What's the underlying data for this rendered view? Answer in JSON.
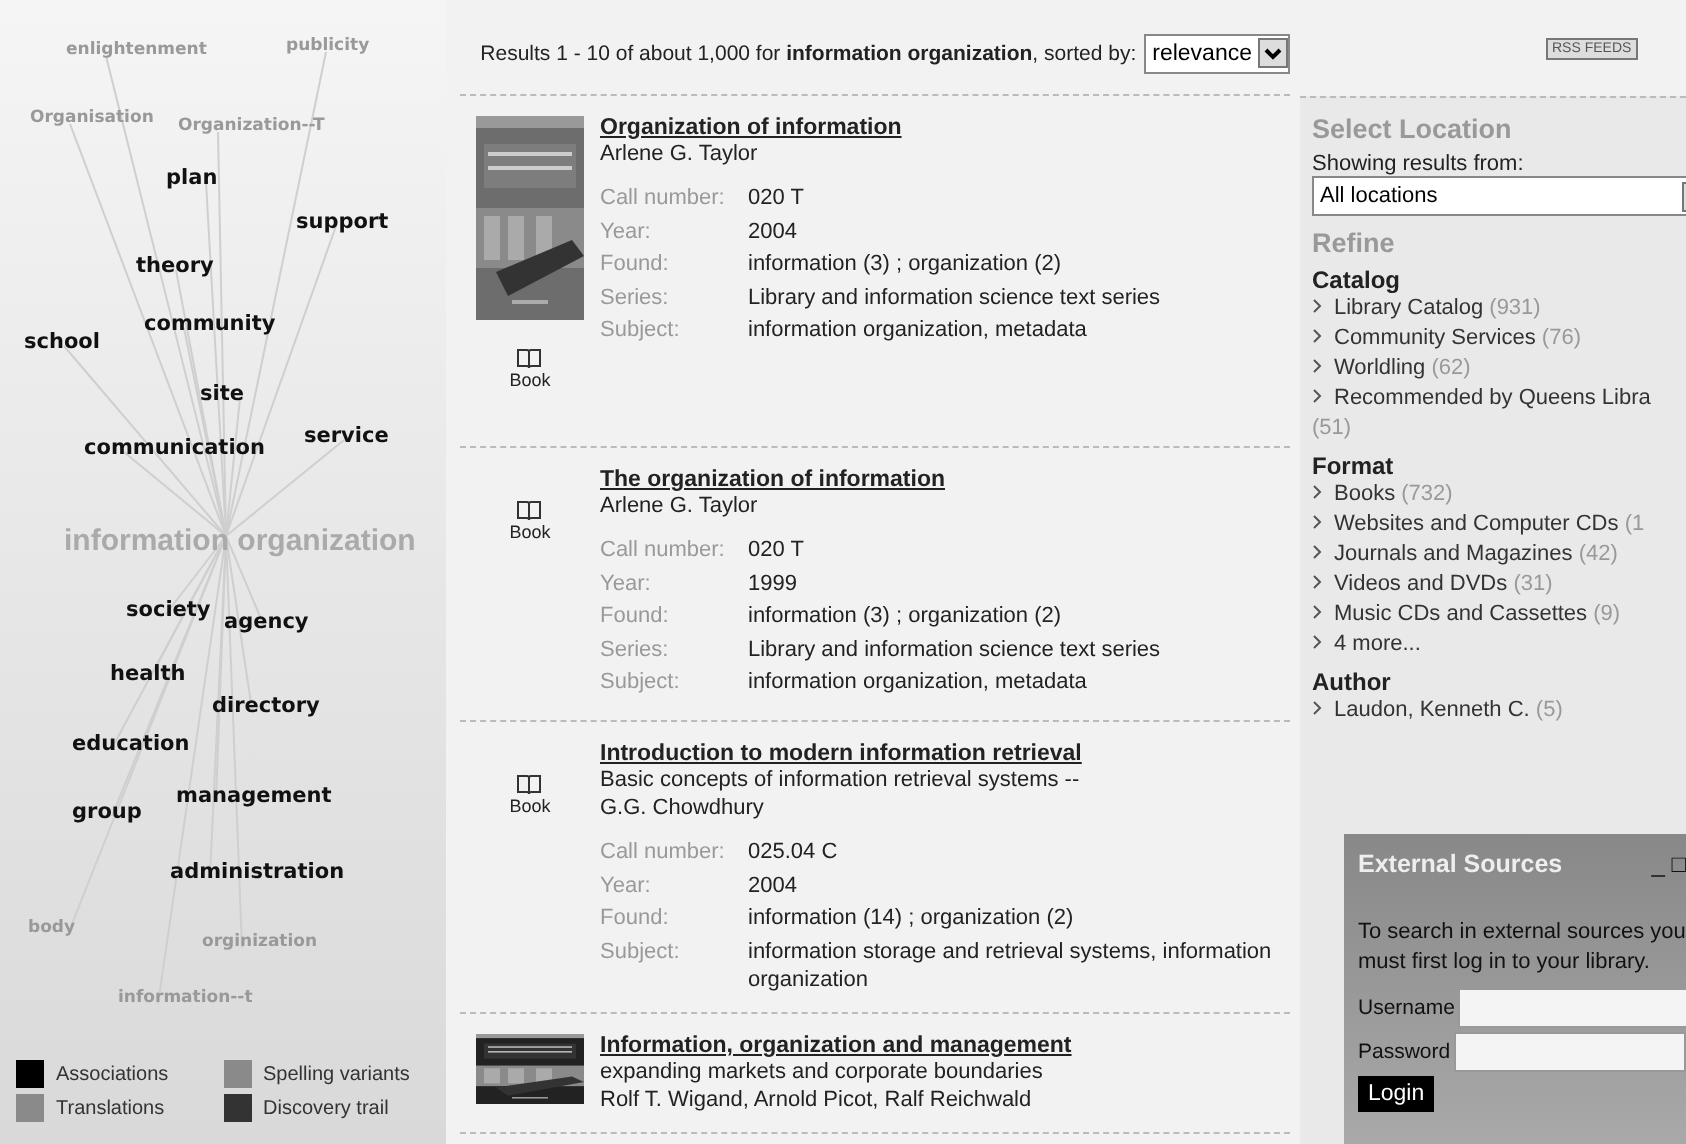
{
  "word_cloud": {
    "center": "information organization",
    "words": [
      {
        "text": "enlightenment",
        "kind": "variant"
      },
      {
        "text": "publicity",
        "kind": "variant"
      },
      {
        "text": "Organisation",
        "kind": "variant"
      },
      {
        "text": "Organization--T",
        "kind": "variant"
      },
      {
        "text": "plan",
        "kind": "association"
      },
      {
        "text": "support",
        "kind": "association"
      },
      {
        "text": "theory",
        "kind": "association"
      },
      {
        "text": "community",
        "kind": "association"
      },
      {
        "text": "school",
        "kind": "association"
      },
      {
        "text": "site",
        "kind": "association"
      },
      {
        "text": "communication",
        "kind": "association"
      },
      {
        "text": "service",
        "kind": "association"
      },
      {
        "text": "society",
        "kind": "association"
      },
      {
        "text": "agency",
        "kind": "association"
      },
      {
        "text": "health",
        "kind": "association"
      },
      {
        "text": "directory",
        "kind": "association"
      },
      {
        "text": "education",
        "kind": "association"
      },
      {
        "text": "group",
        "kind": "association"
      },
      {
        "text": "management",
        "kind": "association"
      },
      {
        "text": "administration",
        "kind": "association"
      },
      {
        "text": "body",
        "kind": "variant"
      },
      {
        "text": "orginization",
        "kind": "variant"
      },
      {
        "text": "information--t",
        "kind": "variant"
      }
    ],
    "legend": [
      {
        "label": "Associations",
        "color": "#000000"
      },
      {
        "label": "Spelling variants",
        "color": "#8a8a8a"
      },
      {
        "label": "Translations",
        "color": "#8a8a8a"
      },
      {
        "label": "Discovery trail",
        "color": "#333333"
      }
    ]
  },
  "results_header": {
    "summary": "Results 1 - 10 of about 1,000 for **information organization**, sorted by:",
    "sort": "relevance",
    "rss": "RSS FEEDS"
  },
  "results": [
    {
      "has_cover": true,
      "format": "Book",
      "title": "Organization of information",
      "lines": [
        "Arlene G. Taylor"
      ],
      "fields": [
        {
          "label": "Call number:",
          "value": "020 T"
        },
        {
          "label": "Year:",
          "value": "2004"
        },
        {
          "label": "Found:",
          "value": "information (3) ; organization (2)"
        },
        {
          "label": "Series:",
          "value": "Library and information science text series"
        },
        {
          "label": "Subject:",
          "value": "information organization, metadata"
        }
      ]
    },
    {
      "has_cover": false,
      "format": "Book",
      "title": "The organization of information",
      "lines": [
        "Arlene G. Taylor"
      ],
      "fields": [
        {
          "label": "Call number:",
          "value": "020 T"
        },
        {
          "label": "Year:",
          "value": "1999"
        },
        {
          "label": "Found:",
          "value": "information (3) ; organization (2)"
        },
        {
          "label": "Series:",
          "value": "Library and information science text series"
        },
        {
          "label": "Subject:",
          "value": "information organization, metadata"
        }
      ]
    },
    {
      "has_cover": false,
      "format": "Book",
      "title": "Introduction to modern information retrieval",
      "lines": [
        "Basic concepts of information retrieval systems --",
        "G.G. Chowdhury"
      ],
      "fields": [
        {
          "label": "Call number:",
          "value": "025.04 C"
        },
        {
          "label": "Year:",
          "value": "2004"
        },
        {
          "label": "Found:",
          "value": "information (14) ; organization (2)"
        },
        {
          "label": "Subject:",
          "value": "information storage and retrieval systems, information organization"
        }
      ]
    },
    {
      "has_cover": true,
      "title": "Information, organization and management",
      "lines": [
        "expanding markets and corporate boundaries",
        "Rolf T. Wigand,  Arnold Picot,  Ralf Reichwald"
      ]
    }
  ],
  "sidebar": {
    "location_title": "Select Location",
    "location_label": "Showing results from:",
    "location_value": "All locations",
    "refine_title": "Refine",
    "groups": [
      {
        "title": "Catalog",
        "items": [
          {
            "label": "Library Catalog",
            "count": "(931)"
          },
          {
            "label": "Community Services",
            "count": "(76)"
          },
          {
            "label": "Worldling",
            "count": "(62)"
          },
          {
            "label": "Recommended by Queens Libra",
            "count": "(51)"
          }
        ]
      },
      {
        "title": "Format",
        "items": [
          {
            "label": "Books",
            "count": "(732)"
          },
          {
            "label": "Websites and Computer CDs",
            "count": "(1"
          },
          {
            "label": "Journals and Magazines",
            "count": "(42)"
          },
          {
            "label": "Videos and DVDs",
            "count": "(31)"
          },
          {
            "label": "Music CDs and Cassettes",
            "count": "(9)"
          },
          {
            "label": "4 more..."
          }
        ]
      },
      {
        "title": "Author",
        "items": [
          {
            "label": "Laudon, Kenneth C.",
            "count": "(5)"
          }
        ]
      }
    ]
  },
  "external_sources": {
    "title": "External Sources",
    "controls": "_ □",
    "message": "To search in external sources you must first log in to your library.",
    "username_label": "Username",
    "password_label": "Password",
    "login": "Login"
  }
}
